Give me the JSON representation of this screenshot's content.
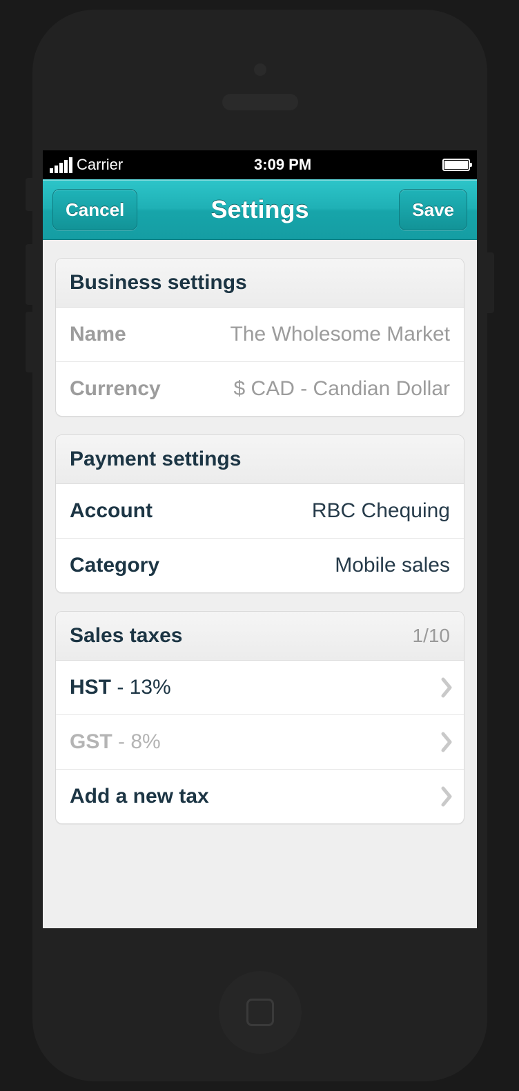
{
  "status": {
    "carrier": "Carrier",
    "time": "3:09 PM"
  },
  "nav": {
    "cancel": "Cancel",
    "title": "Settings",
    "save": "Save"
  },
  "business": {
    "header": "Business settings",
    "name_label": "Name",
    "name_value": "The Wholesome Market",
    "currency_label": "Currency",
    "currency_value": "$ CAD - Candian Dollar"
  },
  "payment": {
    "header": "Payment settings",
    "account_label": "Account",
    "account_value": "RBC Chequing",
    "category_label": "Category",
    "category_value": "Mobile sales"
  },
  "taxes": {
    "header": "Sales taxes",
    "counter": "1/10",
    "items": [
      {
        "code": "HST",
        "rate": "13%",
        "muted": false
      },
      {
        "code": "GST",
        "rate": "8%",
        "muted": true
      }
    ],
    "add_label": "Add a new tax"
  }
}
